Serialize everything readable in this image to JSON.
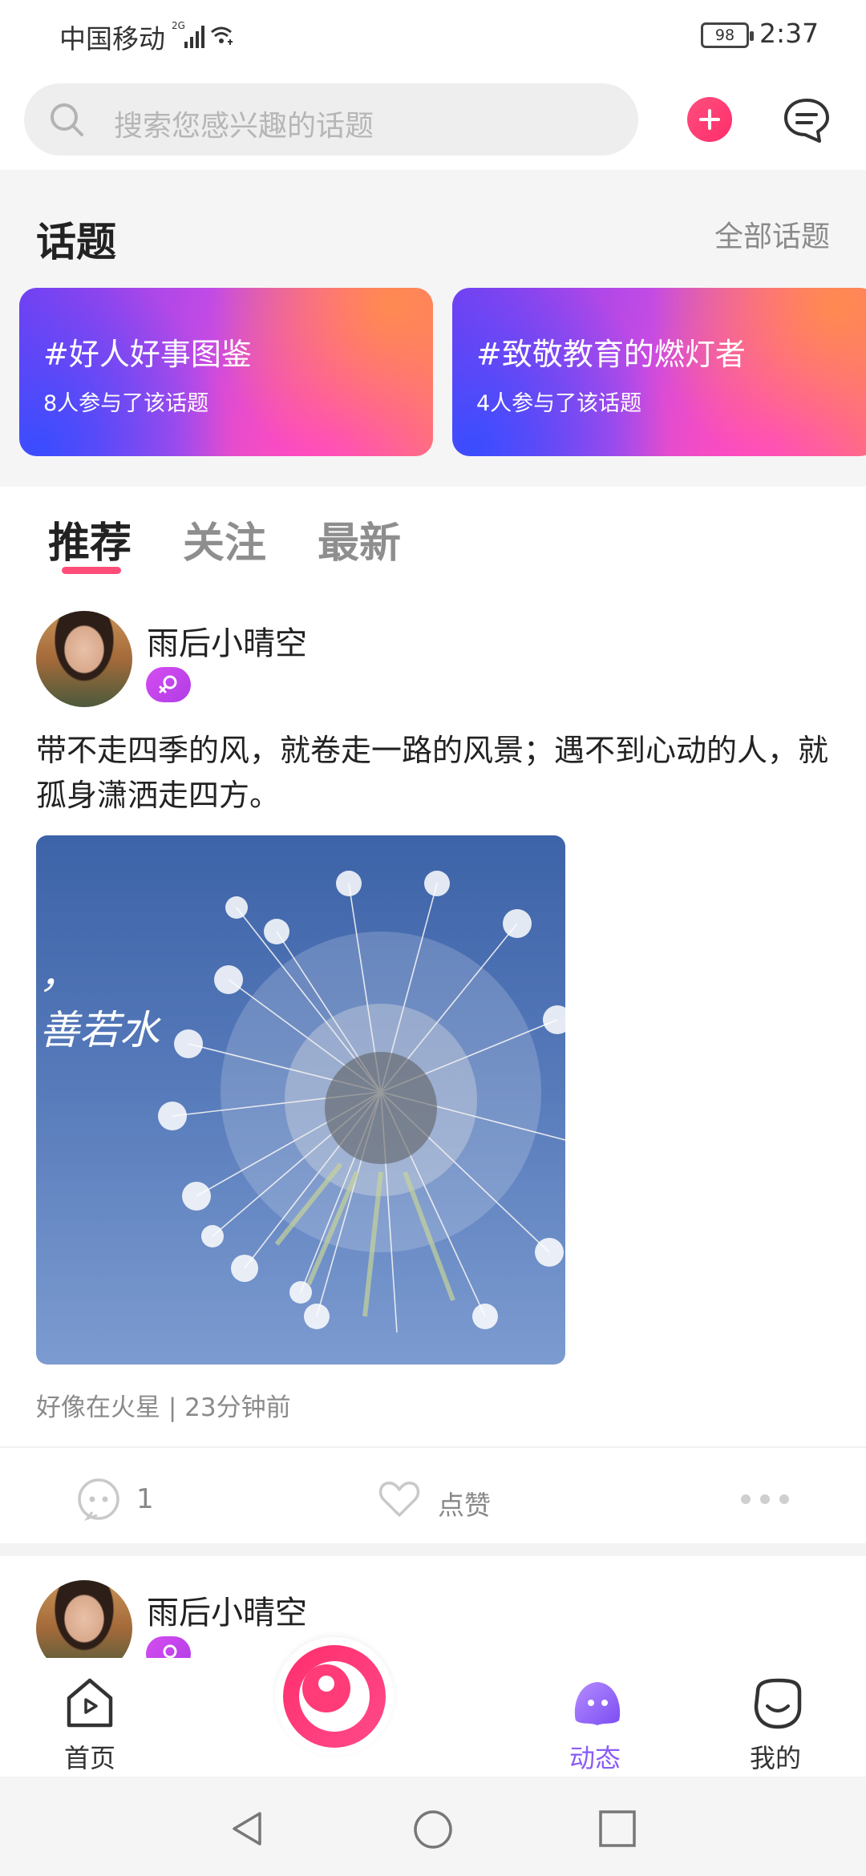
{
  "status_bar": {
    "carrier": "中国移动",
    "network": "2G",
    "battery": "98",
    "time": "2:37"
  },
  "header": {
    "search_placeholder": "搜索您感兴趣的话题",
    "icons": [
      "search-icon",
      "add-icon",
      "message-icon"
    ]
  },
  "topics": {
    "title": "话题",
    "all_link": "全部话题",
    "items": [
      {
        "name": "#好人好事图鉴",
        "count": "8人参与了该话题"
      },
      {
        "name": "#致敬教育的燃灯者",
        "count": "4人参与了该话题"
      }
    ]
  },
  "tabs": {
    "items": [
      "推荐",
      "关注",
      "最新"
    ],
    "active": "推荐",
    "indicator_color": "#ff4d79"
  },
  "posts": [
    {
      "username": "雨后小晴空",
      "gender": "female",
      "text": "带不走四季的风，就卷走一路的风景；遇不到心动的人，就孤身潇洒走四方。",
      "image_text_line1": "，",
      "image_text_line2": "善若水",
      "meta": "好像在火星 | 23分钟前",
      "comments": "1",
      "like_label": "点赞"
    },
    {
      "username": "雨后小晴空",
      "gender": "female"
    }
  ],
  "bottom_nav": {
    "items": [
      {
        "label": "首页",
        "icon": "home-icon"
      },
      {
        "label": "",
        "icon": "camera-icon"
      },
      {
        "label": "动态",
        "icon": "moments-icon",
        "active": true
      },
      {
        "label": "我的",
        "icon": "profile-icon"
      }
    ],
    "active_color": "#8b5cf6"
  },
  "system_nav": {
    "icons": [
      "back-icon",
      "home-circle-icon",
      "recents-icon"
    ]
  }
}
